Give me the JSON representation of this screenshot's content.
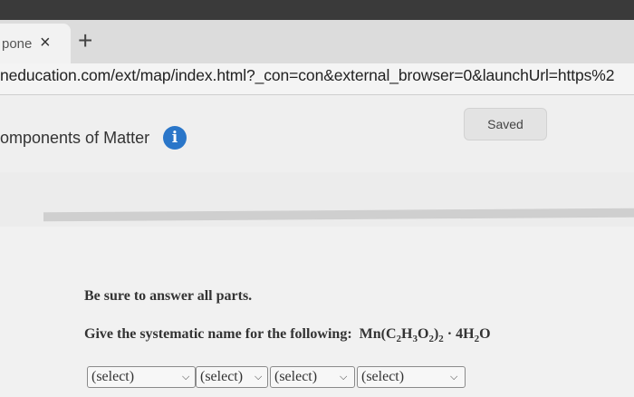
{
  "browser": {
    "tab_title": "pone",
    "tab_close_glyph": "×",
    "new_tab_glyph": "+",
    "url": "neducation.com/ext/map/index.html?_con=con&external_browser=0&launchUrl=https%2"
  },
  "header": {
    "title": "omponents of Matter",
    "info_icon_glyph": "i",
    "saved_label": "Saved"
  },
  "question": {
    "instructions": "Be sure to answer all parts.",
    "prompt": "Give the systematic name for the following:",
    "formula": {
      "mn": "Mn(C",
      "c_sub": "2",
      "h": "H",
      "h_sub": "3",
      "o": "O",
      "o_sub": "2",
      "close": ")",
      "outer_sub": "2",
      "dot": " · ",
      "water_coef": "4H",
      "water_sub": "2",
      "water_o": "O"
    },
    "selects": [
      "(select)",
      "(select)",
      "(select)",
      "(select)"
    ]
  },
  "icons": {
    "info": "info-icon",
    "chevron": "chevron-down-icon"
  },
  "colors": {
    "info_blue": "#2a76c9"
  }
}
